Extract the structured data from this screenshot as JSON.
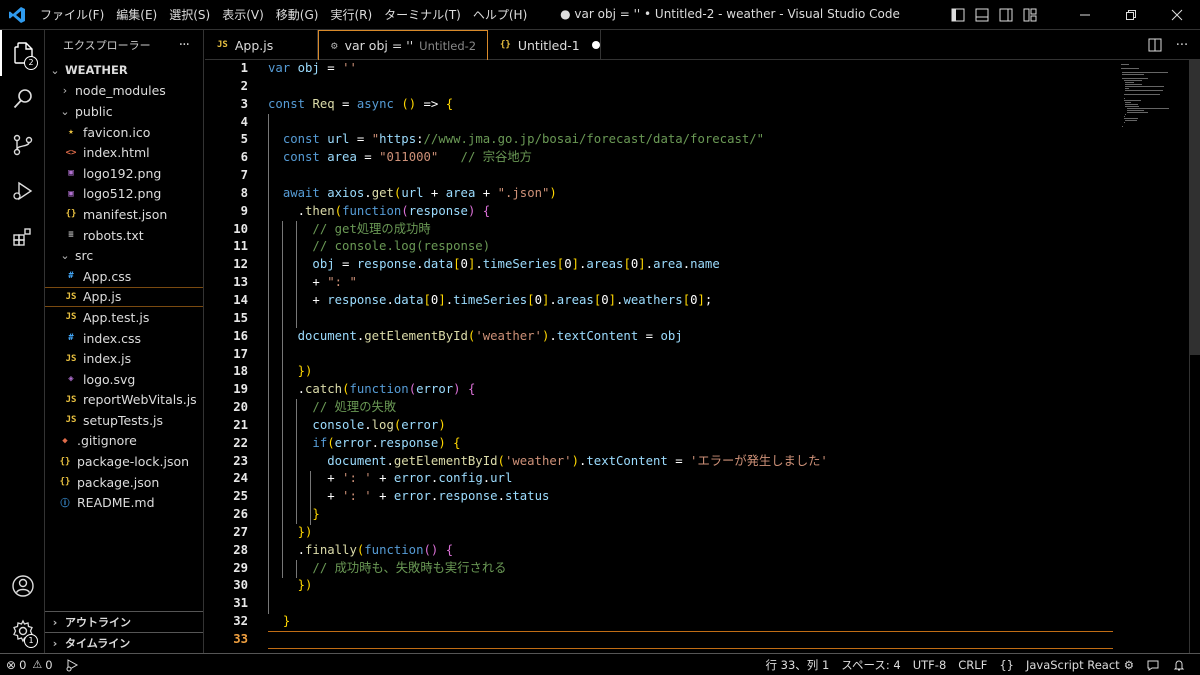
{
  "window_title": "● var obj = '' • Untitled-2 - weather - Visual Studio Code",
  "menu": [
    "ファイル(F)",
    "編集(E)",
    "選択(S)",
    "表示(V)",
    "移動(G)",
    "実行(R)",
    "ターミナル(T)",
    "ヘルプ(H)"
  ],
  "activity_bar": {
    "explorer_badge": "2",
    "manage_badge": "1",
    "icons": [
      "files-icon",
      "search-icon",
      "source-control-icon",
      "run-debug-icon",
      "extensions-icon",
      "account-icon",
      "manage-gear-icon"
    ]
  },
  "sidebar": {
    "title": "エクスプローラー",
    "more": "···",
    "root": "WEATHER",
    "items": [
      {
        "label": "node_modules",
        "icon": "chevron",
        "color": "#cccccc",
        "depth": 1,
        "chev": "›"
      },
      {
        "label": "public",
        "icon": "chevron",
        "color": "#cccccc",
        "depth": 1,
        "chev": "⌄"
      },
      {
        "label": "favicon.ico",
        "icon": "★",
        "color": "#e8c040",
        "depth": 2
      },
      {
        "label": "index.html",
        "icon": "<>",
        "color": "#e06c4a",
        "depth": 2
      },
      {
        "label": "logo192.png",
        "icon": "▣",
        "color": "#b070d0",
        "depth": 2
      },
      {
        "label": "logo512.png",
        "icon": "▣",
        "color": "#b070d0",
        "depth": 2
      },
      {
        "label": "manifest.json",
        "icon": "{}",
        "color": "#e8c040",
        "depth": 2
      },
      {
        "label": "robots.txt",
        "icon": "≡",
        "color": "#cccccc",
        "depth": 2
      },
      {
        "label": "src",
        "icon": "chevron",
        "color": "#cccccc",
        "depth": 1,
        "chev": "⌄"
      },
      {
        "label": "App.css",
        "icon": "#",
        "color": "#42a5f5",
        "depth": 2
      },
      {
        "label": "App.js",
        "icon": "JS",
        "color": "#e8c040",
        "depth": 2,
        "selected": true
      },
      {
        "label": "App.test.js",
        "icon": "JS",
        "color": "#e8c040",
        "depth": 2
      },
      {
        "label": "index.css",
        "icon": "#",
        "color": "#42a5f5",
        "depth": 2
      },
      {
        "label": "index.js",
        "icon": "JS",
        "color": "#e8c040",
        "depth": 2
      },
      {
        "label": "logo.svg",
        "icon": "◈",
        "color": "#b070d0",
        "depth": 2
      },
      {
        "label": "reportWebVitals.js",
        "icon": "JS",
        "color": "#e8c040",
        "depth": 2
      },
      {
        "label": "setupTests.js",
        "icon": "JS",
        "color": "#e8c040",
        "depth": 2
      },
      {
        "label": ".gitignore",
        "icon": "◆",
        "color": "#e06c4a",
        "depth": 1
      },
      {
        "label": "package-lock.json",
        "icon": "{}",
        "color": "#e8c040",
        "depth": 1
      },
      {
        "label": "package.json",
        "icon": "{}",
        "color": "#e8c040",
        "depth": 1
      },
      {
        "label": "README.md",
        "icon": "ⓘ",
        "color": "#42a5f5",
        "depth": 1
      }
    ],
    "outline": "アウトライン",
    "timeline": "タイムライン"
  },
  "tabs": [
    {
      "label": "App.js",
      "icon": "JS",
      "icon_color": "#e8c040",
      "description": "",
      "dirty": false,
      "active": false
    },
    {
      "label": "var obj = ''",
      "icon": "⚙",
      "icon_color": "#aaaaaa",
      "description": "Untitled-2",
      "dirty": true,
      "active": true
    },
    {
      "label": "Untitled-1",
      "icon": "{}",
      "icon_color": "#e8c040",
      "description": "",
      "dirty": true,
      "active": false
    }
  ],
  "editor": {
    "current_line": 33,
    "lines": [
      "var obj = ''",
      "",
      "const Req = async () => {",
      "",
      "  const url = \"https://www.jma.go.jp/bosai/forecast/data/forecast/\"",
      "  const area = \"011000\"   // 宗谷地方",
      "",
      "  await axios.get(url + area + \".json\")",
      "    .then(function(response) {",
      "      // get処理の成功時",
      "      // console.log(response)",
      "      obj = response.data[0].timeSeries[0].areas[0].area.name",
      "      + \": \"",
      "      + response.data[0].timeSeries[0].areas[0].weathers[0];",
      "",
      "    document.getElementById('weather').textContent = obj",
      "",
      "    })",
      "    .catch(function(error) {",
      "      // 処理の失敗",
      "      console.log(error)",
      "      if(error.response) {",
      "        document.getElementById('weather').textContent = 'エラーが発生しました'",
      "        + ': ' + error.config.url",
      "        + ': ' + error.response.status",
      "      }",
      "    })",
      "    .finally(function() {",
      "      // 成功時も、失敗時も実行される",
      "    })",
      "",
      "  }",
      ""
    ]
  },
  "status_bar": {
    "errors": "0",
    "warnings": "0",
    "position": "行 33、列 1",
    "spaces": "スペース: 4",
    "encoding": "UTF-8",
    "eol": "CRLF",
    "braces": "{}",
    "language": "JavaScript React"
  }
}
